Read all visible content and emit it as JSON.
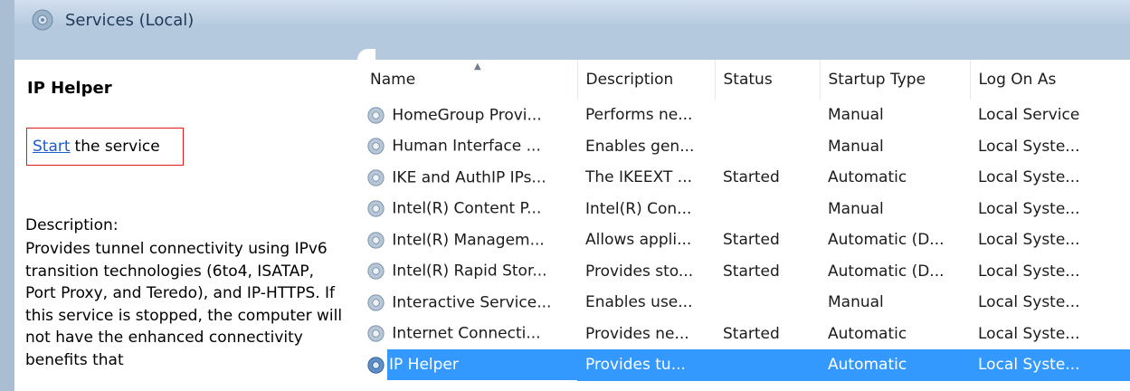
{
  "header": {
    "title": "Services (Local)",
    "icon": "services-gear-icon"
  },
  "left_pane": {
    "service_name": "IP Helper",
    "start_link": "Start",
    "start_suffix": "the service",
    "description_label": "Description:",
    "description_text": "Provides tunnel connectivity using IPv6 transition technologies (6to4, ISATAP, Port Proxy, and Teredo), and IP-HTTPS. If this service is stopped, the computer will not have the enhanced connectivity benefits that"
  },
  "table": {
    "columns": [
      "Name",
      "Description",
      "Status",
      "Startup Type",
      "Log On As"
    ],
    "sorted_column": "Name",
    "rows": [
      {
        "name": "HomeGroup Provi...",
        "description": "Performs ne...",
        "status": "",
        "startup": "Manual",
        "logon": "Local Service"
      },
      {
        "name": "Human Interface ...",
        "description": "Enables gen...",
        "status": "",
        "startup": "Manual",
        "logon": "Local Syste..."
      },
      {
        "name": "IKE and AuthIP IPs...",
        "description": "The IKEEXT ...",
        "status": "Started",
        "startup": "Automatic",
        "logon": "Local Syste..."
      },
      {
        "name": "Intel(R) Content P...",
        "description": "Intel(R) Con...",
        "status": "",
        "startup": "Manual",
        "logon": "Local Syste..."
      },
      {
        "name": "Intel(R) Managem...",
        "description": "Allows appli...",
        "status": "Started",
        "startup": "Automatic (D...",
        "logon": "Local Syste..."
      },
      {
        "name": "Intel(R) Rapid Stor...",
        "description": "Provides sto...",
        "status": "Started",
        "startup": "Automatic (D...",
        "logon": "Local Syste..."
      },
      {
        "name": "Interactive Service...",
        "description": "Enables use...",
        "status": "",
        "startup": "Manual",
        "logon": "Local Syste..."
      },
      {
        "name": "Internet Connecti...",
        "description": "Provides ne...",
        "status": "Started",
        "startup": "Automatic",
        "logon": "Local Syste..."
      },
      {
        "name": "IP Helper",
        "description": "Provides tu...",
        "status": "",
        "startup": "Automatic",
        "logon": "Local Syste..."
      }
    ],
    "selected_row": "IP Helper"
  },
  "colors": {
    "header_bg": "#b4c8de",
    "selection": "#3399ff",
    "link": "#1a5ccb",
    "highlight_box": "#e01b1b"
  }
}
